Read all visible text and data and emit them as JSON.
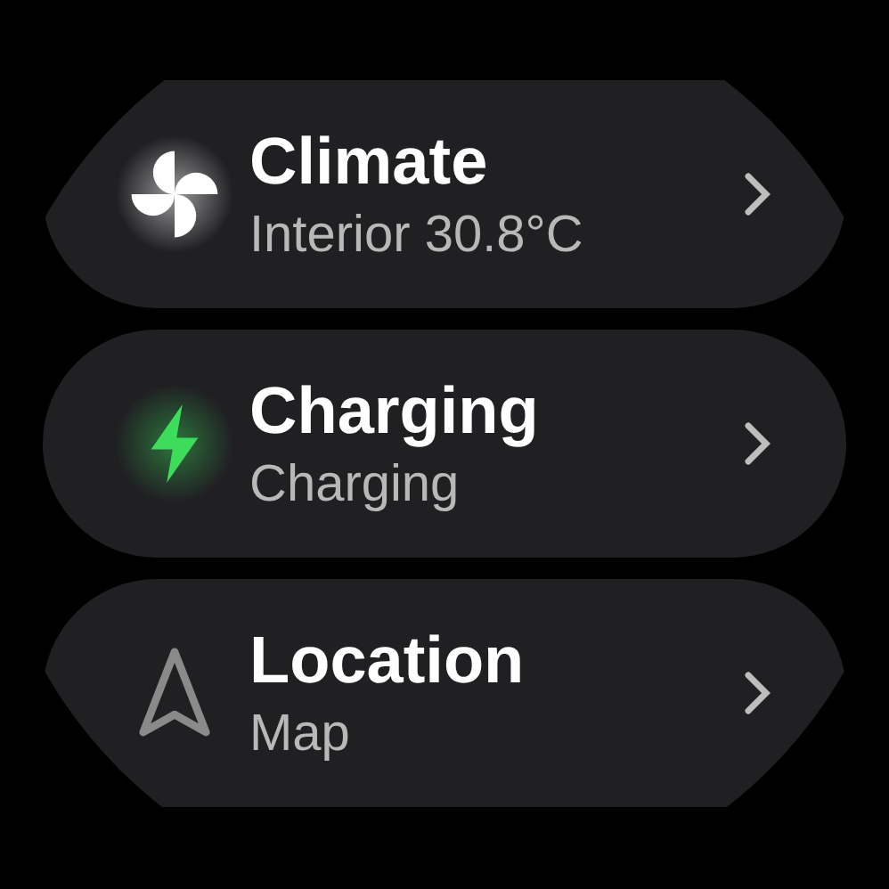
{
  "items": [
    {
      "kind": "fan",
      "title": "Climate",
      "subtitle": "Interior 30.8°C"
    },
    {
      "kind": "bolt",
      "title": "Charging",
      "subtitle": "Charging"
    },
    {
      "kind": "navigation",
      "title": "Location",
      "subtitle": "Map"
    }
  ]
}
